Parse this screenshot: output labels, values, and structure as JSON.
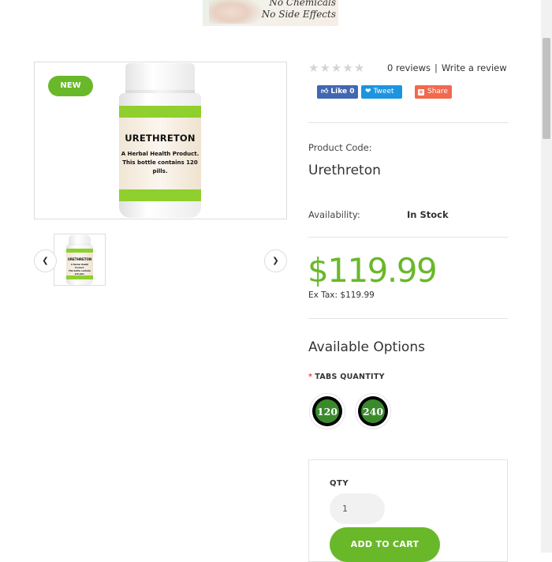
{
  "banner": {
    "line1": "No Chemicals",
    "line2": "No Side Effects"
  },
  "product_image": {
    "badge": "NEW",
    "bottle_label_title": "URETHRETON",
    "bottle_label_line1": "A Herbal Health Product.",
    "bottle_label_line2": "This bottle contains 120 pills."
  },
  "gallery": {
    "prev_icon": "chevron-left-icon",
    "next_icon": "chevron-right-icon"
  },
  "rating": {
    "stars_filled": 0,
    "stars_total": 5,
    "reviews_link": "0 reviews",
    "separator": "|",
    "write_link": "Write a review"
  },
  "social": {
    "like_label": "Like",
    "like_count": "0",
    "tweet_label": "Tweet",
    "share_label": "Share"
  },
  "product": {
    "code_label": "Product Code:",
    "code_value": "Urethreton",
    "availability_label": "Availability:",
    "availability_value": "In Stock",
    "price": "$119.99",
    "ex_tax": "Ex Tax: $119.99"
  },
  "options": {
    "title": "Available Options",
    "required_mark": "*",
    "quantity_label": "TABS QUANTITY",
    "choices": [
      "120",
      "240"
    ]
  },
  "cart": {
    "qty_label": "QTY",
    "qty_value": "1",
    "add_label": "ADD TO CART"
  },
  "colors": {
    "accent_green": "#69b82a",
    "facebook": "#4267b2",
    "twitter": "#1b95e0",
    "share": "#f1694f"
  }
}
